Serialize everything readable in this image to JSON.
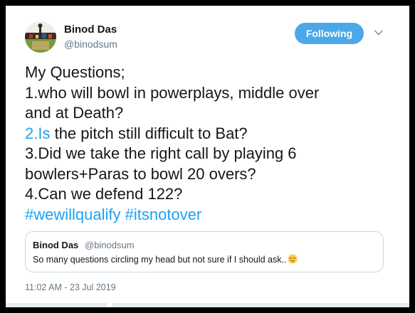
{
  "author": {
    "name": "Binod Das",
    "handle": "@binodsum",
    "avatar_icon": "profile-photo-stadium"
  },
  "follow_button": {
    "label": "Following",
    "color": "#4aa8e8"
  },
  "menu_icon": "chevron-down-icon",
  "tweet": {
    "line1": "My Questions;",
    "line2": "1.who will bowl in powerplays, middle over",
    "line3": "and at Death?",
    "line4_link": "2.Is",
    "line4_rest": " the pitch still difficult to Bat?",
    "line5": "3.Did we take the right call by playing 6",
    "line6": "bowlers+Paras to bowl 20 overs?",
    "line7": "4.Can we defend 122?",
    "hashtag1": "#wewillqualify",
    "hashtag2": "#itsnotover",
    "link_color": "#1da1f2"
  },
  "quoted_tweet": {
    "name": "Binod Das",
    "handle": "@binodsum",
    "text": "So many questions circling my head but not sure if I should ask..",
    "emoji": "relieved-face-emoji"
  },
  "timestamp": "11:02 AM - 23 Jul 2019"
}
